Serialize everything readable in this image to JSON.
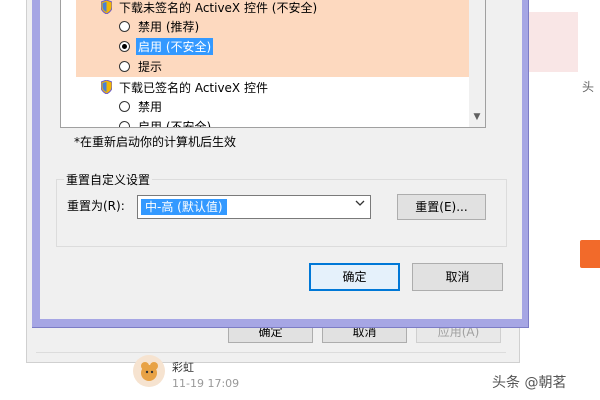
{
  "background": {
    "edge_char": "头",
    "accent_color": "#f26a2a"
  },
  "parent_dialog": {
    "ok_label": "确定",
    "cancel_label": "取消",
    "apply_label": "应用(A)"
  },
  "feed": {
    "name": "彩虹",
    "time": "11-19 17:09"
  },
  "watermark": "头条 @朝茗",
  "settings_list": {
    "items": [
      {
        "type": "heading",
        "icon": "shield-icon",
        "label": "下载未签名的 ActiveX 控件 (不安全)"
      },
      {
        "type": "radio",
        "checked": false,
        "label": "禁用 (推荐)"
      },
      {
        "type": "radio",
        "checked": true,
        "label": "启用 (不安全)"
      },
      {
        "type": "radio",
        "checked": false,
        "label": "提示"
      },
      {
        "type": "heading",
        "icon": "shield-icon",
        "label": "下载已签名的 ActiveX 控件"
      },
      {
        "type": "radio",
        "checked": false,
        "label": "禁用"
      },
      {
        "type": "radio",
        "checked": false,
        "label": "启用 (不安全)"
      }
    ],
    "highlight_color": "#fdd9bf"
  },
  "restart_note": "*在重新启动你的计算机后生效",
  "reset_group": {
    "title": "重置自定义设置",
    "reset_to_label": "重置为(R):",
    "selected_level": "中-高 (默认值)",
    "reset_button": "重置(E)..."
  },
  "dialog_buttons": {
    "ok": "确定",
    "cancel": "取消"
  }
}
